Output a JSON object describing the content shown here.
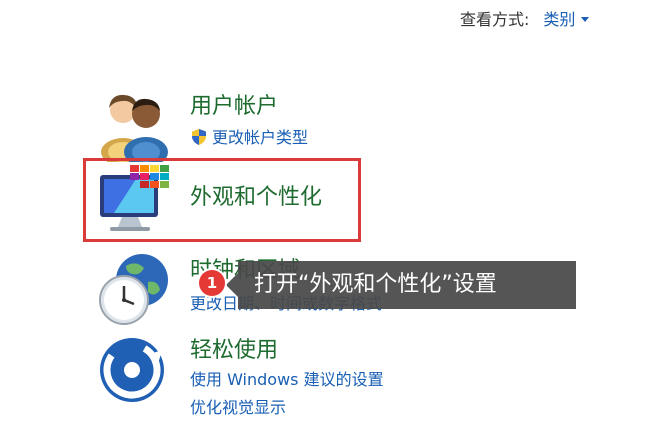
{
  "view_by": {
    "label": "查看方式:",
    "value": "类别"
  },
  "categories": [
    {
      "id": "user-accounts",
      "title": "用户帐户",
      "links": [
        "更改帐户类型"
      ],
      "icon": "users-icon"
    },
    {
      "id": "appearance",
      "title": "外观和个性化",
      "links": [],
      "icon": "appearance-monitor-icon",
      "highlighted": true,
      "highlight_color": "#d93a3a"
    },
    {
      "id": "clock-region",
      "title": "时钟和区域",
      "links": [
        "更改日期、时间或数字格式"
      ],
      "icon": "clock-globe-icon"
    },
    {
      "id": "ease-of-access",
      "title": "轻松使用",
      "links": [
        "使用 Windows 建议的设置",
        "优化视觉显示"
      ],
      "icon": "ease-of-access-icon"
    }
  ],
  "annotation": {
    "step": "1",
    "text": "打开“外观和个性化”设置",
    "badge_color": "#e53935"
  },
  "colors": {
    "category_title": "#1e6b2f",
    "link": "#1a5fb4"
  }
}
